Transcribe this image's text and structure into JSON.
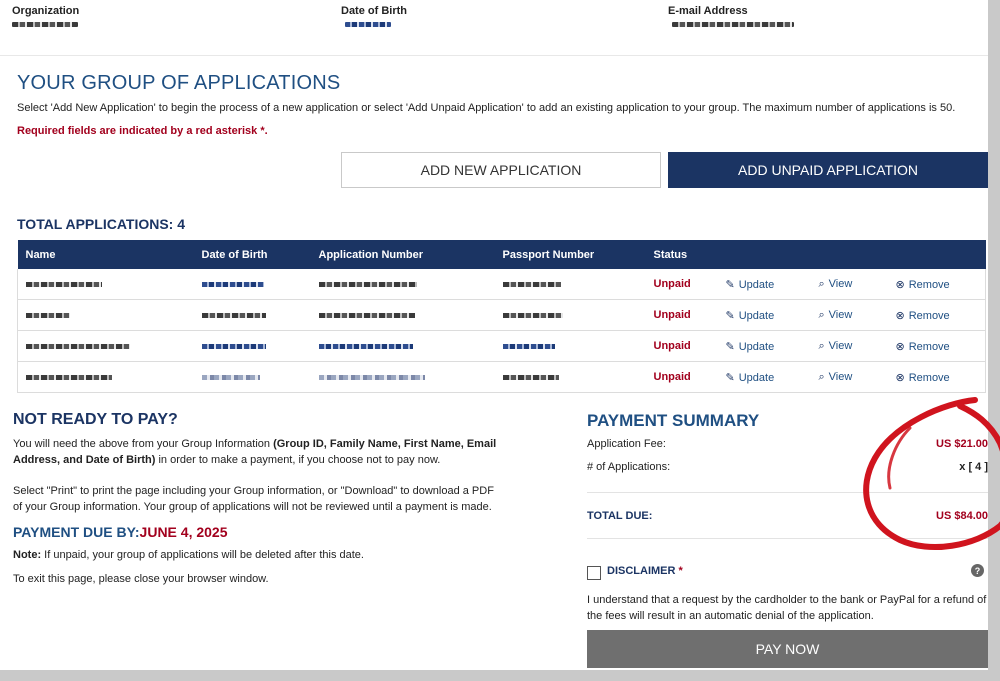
{
  "group_info": {
    "organization_label": "Organization",
    "dob_label": "Date of Birth",
    "email_label": "E-mail Address"
  },
  "group_section": {
    "title": "YOUR GROUP OF APPLICATIONS",
    "instructions": "Select 'Add New Application' to begin the process of a new application or select 'Add Unpaid Application' to add an existing application to your group. The maximum number of applications is 50.",
    "required_note": "Required fields are indicated by a red asterisk *."
  },
  "buttons": {
    "add_new": "ADD NEW APPLICATION",
    "add_unpaid": "ADD UNPAID APPLICATION",
    "pay_now": "PAY NOW"
  },
  "total_applications": "TOTAL APPLICATIONS: 4",
  "table": {
    "headers": [
      "Name",
      "Date of Birth",
      "Application Number",
      "Passport Number",
      "Status"
    ],
    "rows": [
      {
        "status": "Unpaid",
        "update": "Update",
        "view": "View",
        "remove": "Remove"
      },
      {
        "status": "Unpaid",
        "update": "Update",
        "view": "View",
        "remove": "Remove"
      },
      {
        "status": "Unpaid",
        "update": "Update",
        "view": "View",
        "remove": "Remove"
      },
      {
        "status": "Unpaid",
        "update": "Update",
        "view": "View",
        "remove": "Remove"
      }
    ]
  },
  "not_ready": {
    "title": "NOT READY TO PAY?",
    "para1_start": "You will need the above from your Group Information ",
    "para1_bold": "(Group ID, Family Name, First Name, Email Address, and Date of Birth)",
    "para1_end": " in order to make a payment, if you choose not to pay now.",
    "para2": "Select \"Print\" to print the page including your Group information, or \"Download\" to download a PDF of your Group information. Your group of applications will not be reviewed until a payment is made.",
    "due_label": "PAYMENT DUE BY:",
    "due_date": "JUNE 4, 2025",
    "note_bold": "Note:",
    "note_text": " If unpaid, your group of applications will be deleted after this date.",
    "exit_text": "To exit this page, please close your browser window."
  },
  "payment_summary": {
    "title": "PAYMENT SUMMARY",
    "fee_label": "Application Fee:",
    "fee_value": "US $21.00",
    "count_label": "# of Applications:",
    "count_value": "x [ 4 ]",
    "total_label": "TOTAL DUE:",
    "total_value": "US $84.00",
    "disclaimer_label": "DISCLAIMER",
    "disclaimer_star": "*",
    "disclaimer_text": "I understand that a request by the cardholder to the bank or PayPal for a refund of the fees will result in an automatic denial of the application.",
    "help_glyph": "?"
  },
  "colors": {
    "navy": "#1b3463",
    "title_blue": "#1f4f82",
    "red": "#a2001d",
    "annotation_red": "#d0141e",
    "pay_gray": "#6f6f6f"
  },
  "icons": {
    "update": "pencil-icon",
    "view": "magnifier-icon",
    "remove": "x-circle-icon",
    "help": "question-circle-icon"
  }
}
